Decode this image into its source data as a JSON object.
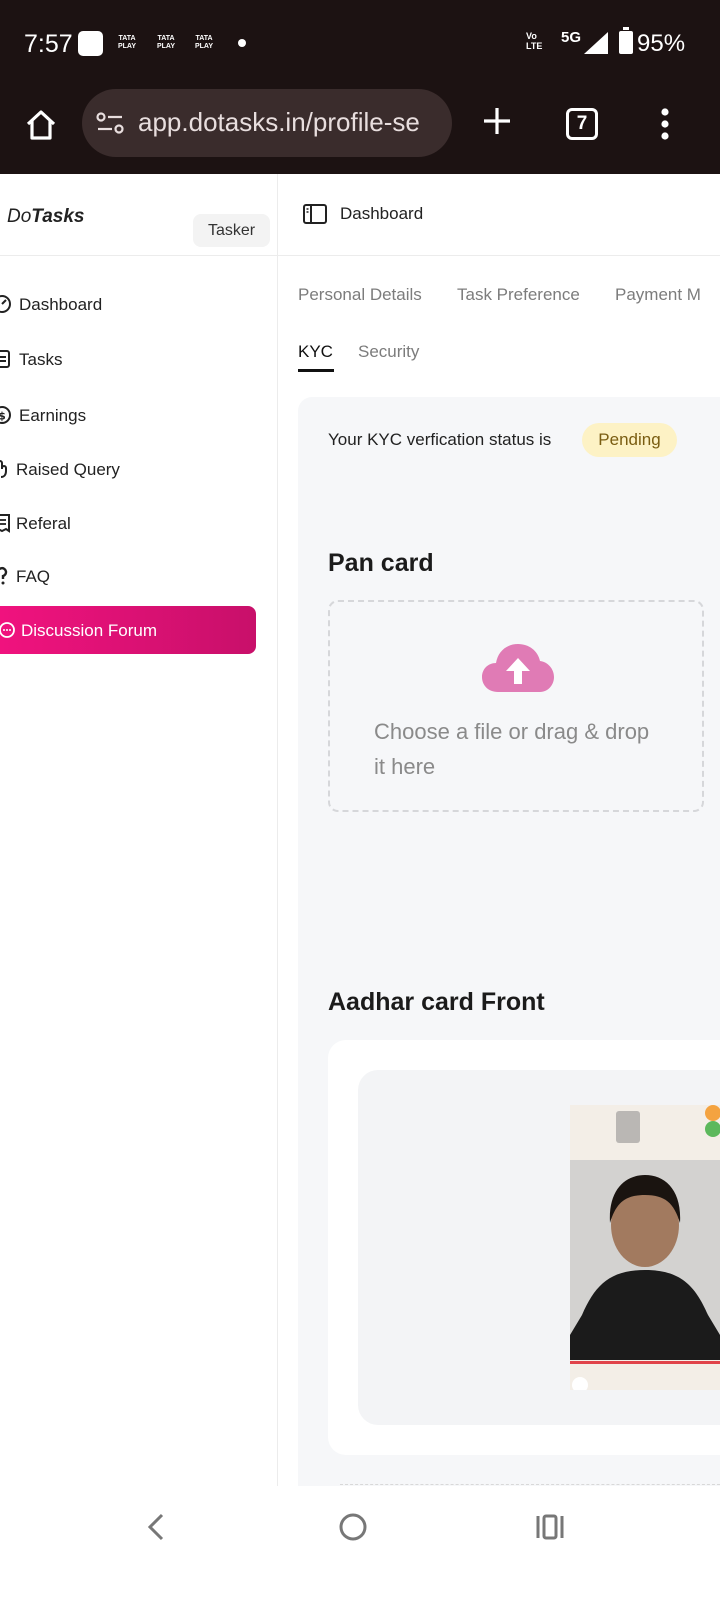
{
  "status_bar": {
    "time": "7:57",
    "notif_icons": [
      "TATA\nPLAY",
      "TATA\nPLAY",
      "TATA\nPLAY"
    ],
    "network_volte": "Vo\nLTE",
    "network_type": "5G",
    "battery": "95%"
  },
  "browser": {
    "url": "app.dotasks.in/profile-se",
    "tab_count": "7"
  },
  "sidebar": {
    "brand_prefix": "Do",
    "brand_suffix": "Tasks",
    "role": "Tasker",
    "items": [
      {
        "label": "Dashboard",
        "icon": "gauge-icon"
      },
      {
        "label": "Tasks",
        "icon": "list-icon"
      },
      {
        "label": "Earnings",
        "icon": "dollar-icon"
      },
      {
        "label": "Raised Query",
        "icon": "hand-icon"
      },
      {
        "label": "Referal",
        "icon": "receipt-icon"
      },
      {
        "label": "FAQ",
        "icon": "question-icon"
      },
      {
        "label": "Discussion Forum",
        "icon": "chat-icon",
        "active": true
      }
    ]
  },
  "topbar": {
    "title": "Dashboard"
  },
  "tabs": [
    {
      "label": "Personal Details"
    },
    {
      "label": "Task Preference"
    },
    {
      "label": "Payment M"
    },
    {
      "label": "KYC",
      "active": true
    },
    {
      "label": "Security"
    }
  ],
  "kyc": {
    "status_text": "Your KYC verfication status is",
    "status_value": "Pending",
    "pan_title": "Pan card",
    "upload_prompt": "Choose a file or drag & drop it here",
    "aadhar_front_title": "Aadhar card Front"
  },
  "colors": {
    "accent": "#f0127e",
    "upload_icon": "#e07bb5",
    "pending_bg": "#fdf2c5",
    "pending_text": "#7a5d12"
  }
}
